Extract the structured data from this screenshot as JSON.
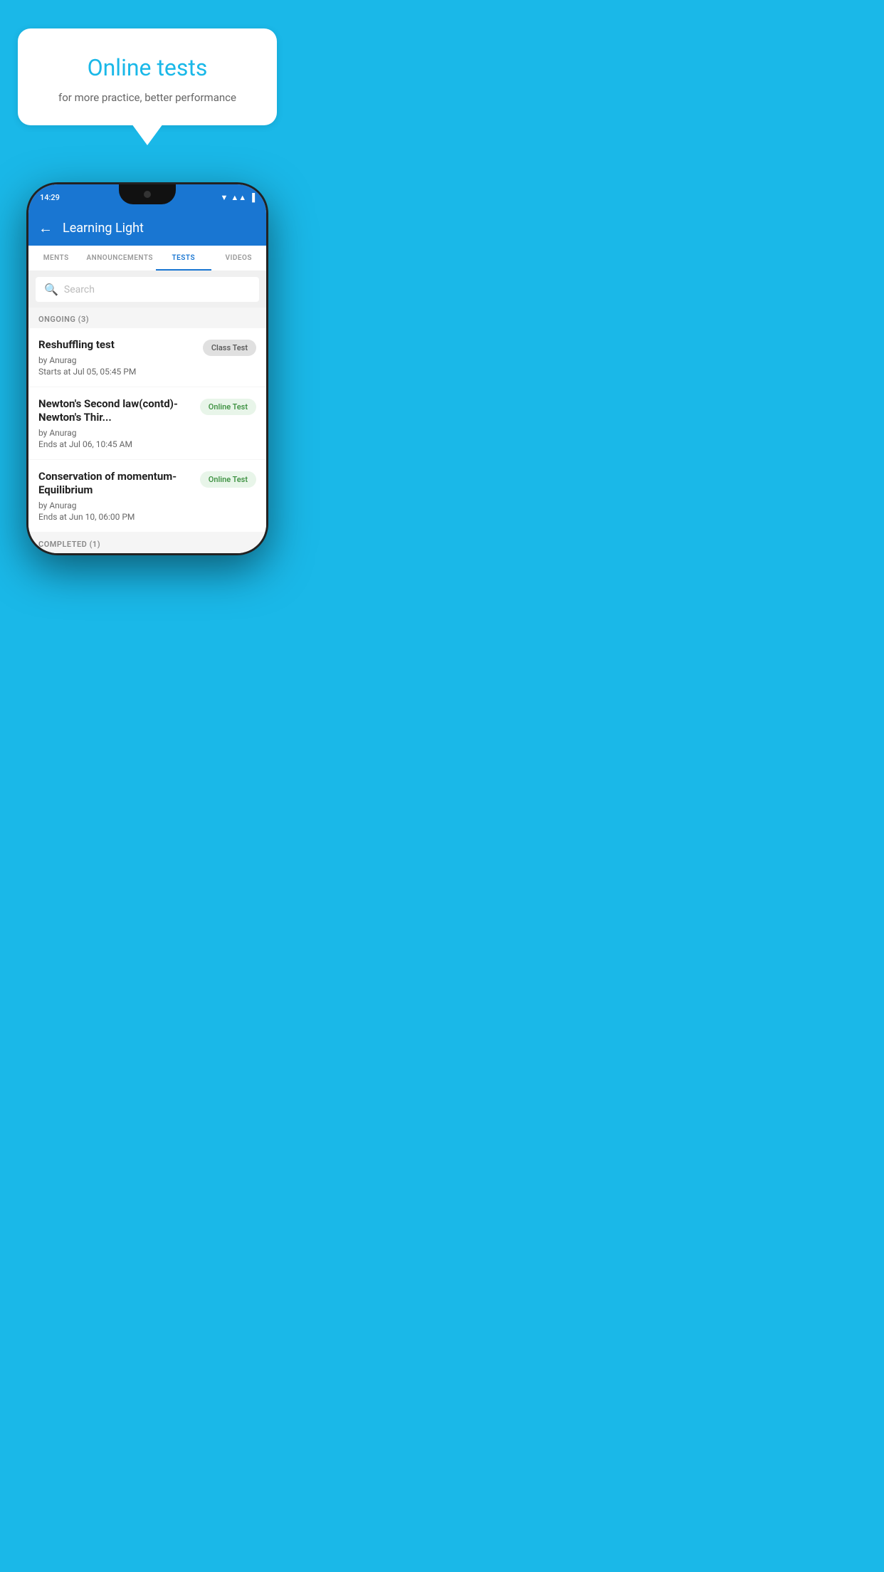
{
  "bubble": {
    "title": "Online tests",
    "subtitle": "for more practice, better performance"
  },
  "phone": {
    "status_time": "14:29",
    "app_title": "Learning Light",
    "tabs": [
      {
        "label": "MENTS",
        "active": false
      },
      {
        "label": "ANNOUNCEMENTS",
        "active": false
      },
      {
        "label": "TESTS",
        "active": true
      },
      {
        "label": "VIDEOS",
        "active": false
      }
    ],
    "search_placeholder": "Search",
    "section_ongoing": "ONGOING (3)",
    "tests": [
      {
        "name": "Reshuffling test",
        "by": "by Anurag",
        "time": "Starts at  Jul 05, 05:45 PM",
        "badge": "Class Test",
        "badge_type": "class"
      },
      {
        "name": "Newton's Second law(contd)-Newton's Thir...",
        "by": "by Anurag",
        "time": "Ends at  Jul 06, 10:45 AM",
        "badge": "Online Test",
        "badge_type": "online"
      },
      {
        "name": "Conservation of momentum-Equilibrium",
        "by": "by Anurag",
        "time": "Ends at  Jun 10, 06:00 PM",
        "badge": "Online Test",
        "badge_type": "online"
      }
    ],
    "section_completed": "COMPLETED (1)"
  }
}
